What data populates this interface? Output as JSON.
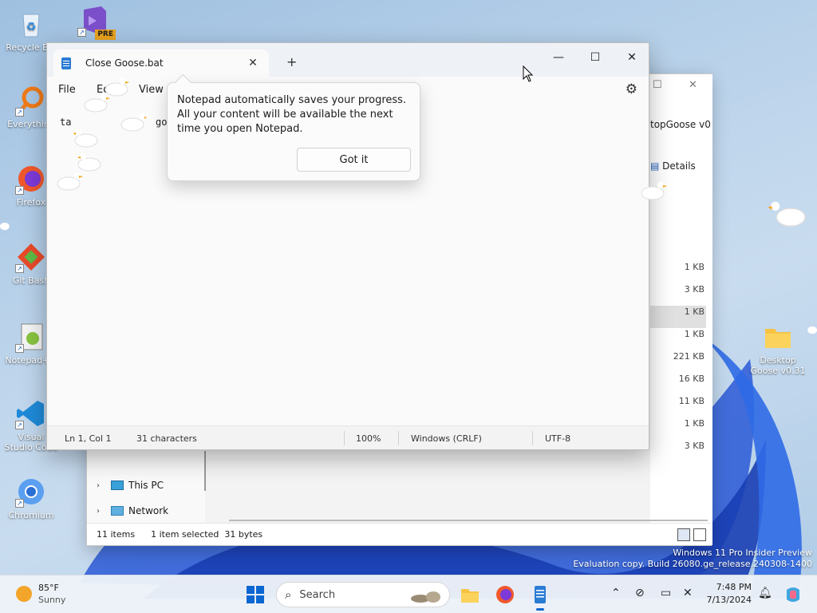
{
  "desktop": {
    "icons": [
      {
        "label": "Recycle Bin",
        "icon": "recycle-bin-icon"
      },
      {
        "label": "PRE",
        "icon": "visual-studio-preview-icon"
      },
      {
        "label": "Everything",
        "icon": "everything-search-icon"
      },
      {
        "label": "Firefox",
        "icon": "firefox-icon"
      },
      {
        "label": "Git Bash",
        "icon": "git-bash-icon"
      },
      {
        "label": "Notepad++",
        "icon": "notepad-plus-plus-icon"
      },
      {
        "label": "Visual Studio Code",
        "icon": "vscode-icon"
      },
      {
        "label": "Chromium",
        "icon": "chromium-icon"
      },
      {
        "label": "Desktop Goose v0.31",
        "icon": "folder-icon"
      }
    ]
  },
  "explorer": {
    "path_fragment": "topGoose v0",
    "details_label": "Details",
    "sizes": [
      "1 KB",
      "3 KB",
      "1 KB",
      "1 KB",
      "221 KB",
      "16 KB",
      "11 KB",
      "1 KB",
      "3 KB"
    ],
    "selected_index": 2,
    "nav": [
      {
        "label": "This PC",
        "icon": "this-pc-icon"
      },
      {
        "label": "Network",
        "icon": "network-icon"
      }
    ],
    "status": {
      "items": "11 items",
      "selection": "1 item selected",
      "size": "31 bytes"
    }
  },
  "notepad": {
    "tab_title": "Close Goose.bat",
    "new_tab": "+",
    "menu": [
      "File",
      "Edit",
      "View"
    ],
    "editor_visible": {
      "start": "ta",
      "end": "go"
    },
    "status": {
      "position": "Ln 1, Col 1",
      "chars": "31 characters",
      "zoom": "100%",
      "eol": "Windows (CRLF)",
      "encoding": "UTF-8"
    },
    "tip": {
      "text": "Notepad automatically saves your progress. All your content will be available the next time you open Notepad.",
      "button": "Got it"
    }
  },
  "watermark": {
    "line1": "Windows 11 Pro Insider Preview",
    "line2": "Evaluation copy. Build 26080.ge_release.240308-1400"
  },
  "taskbar": {
    "weather": {
      "temp": "85°F",
      "condition": "Sunny"
    },
    "search_label": "Search",
    "apps": [
      "file-explorer-icon",
      "firefox-icon",
      "notepad-icon"
    ],
    "active_app": "notepad-icon",
    "clock": {
      "time": "7:48 PM",
      "date": "7/13/2024"
    }
  },
  "colors": {
    "accent": "#0a66d1",
    "goose_beak": "#f4a81d",
    "folder": "#f6c443"
  }
}
